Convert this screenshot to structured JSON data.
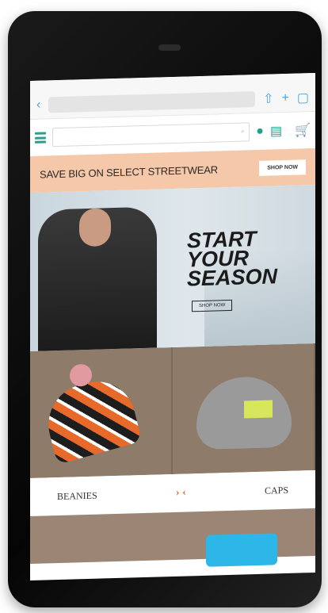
{
  "promo": {
    "text": "SAVE BIG ON SELECT STREETWEAR",
    "button": "SHOP NOW"
  },
  "hero": {
    "title": "START\nYOUR\nSEASON",
    "button": "SHOP NOW"
  },
  "categories": {
    "left": "BEANIES",
    "right": "CAPS",
    "arrows": "› ‹"
  },
  "icons": {
    "back": "‹",
    "share": "⇧",
    "add": "+",
    "tabs": "▢",
    "location": "●",
    "cart": "🛒"
  },
  "colors": {
    "accent_teal": "#1fa38f",
    "promo_bg": "#f4c8a8",
    "accent_orange": "#e86a2b"
  }
}
